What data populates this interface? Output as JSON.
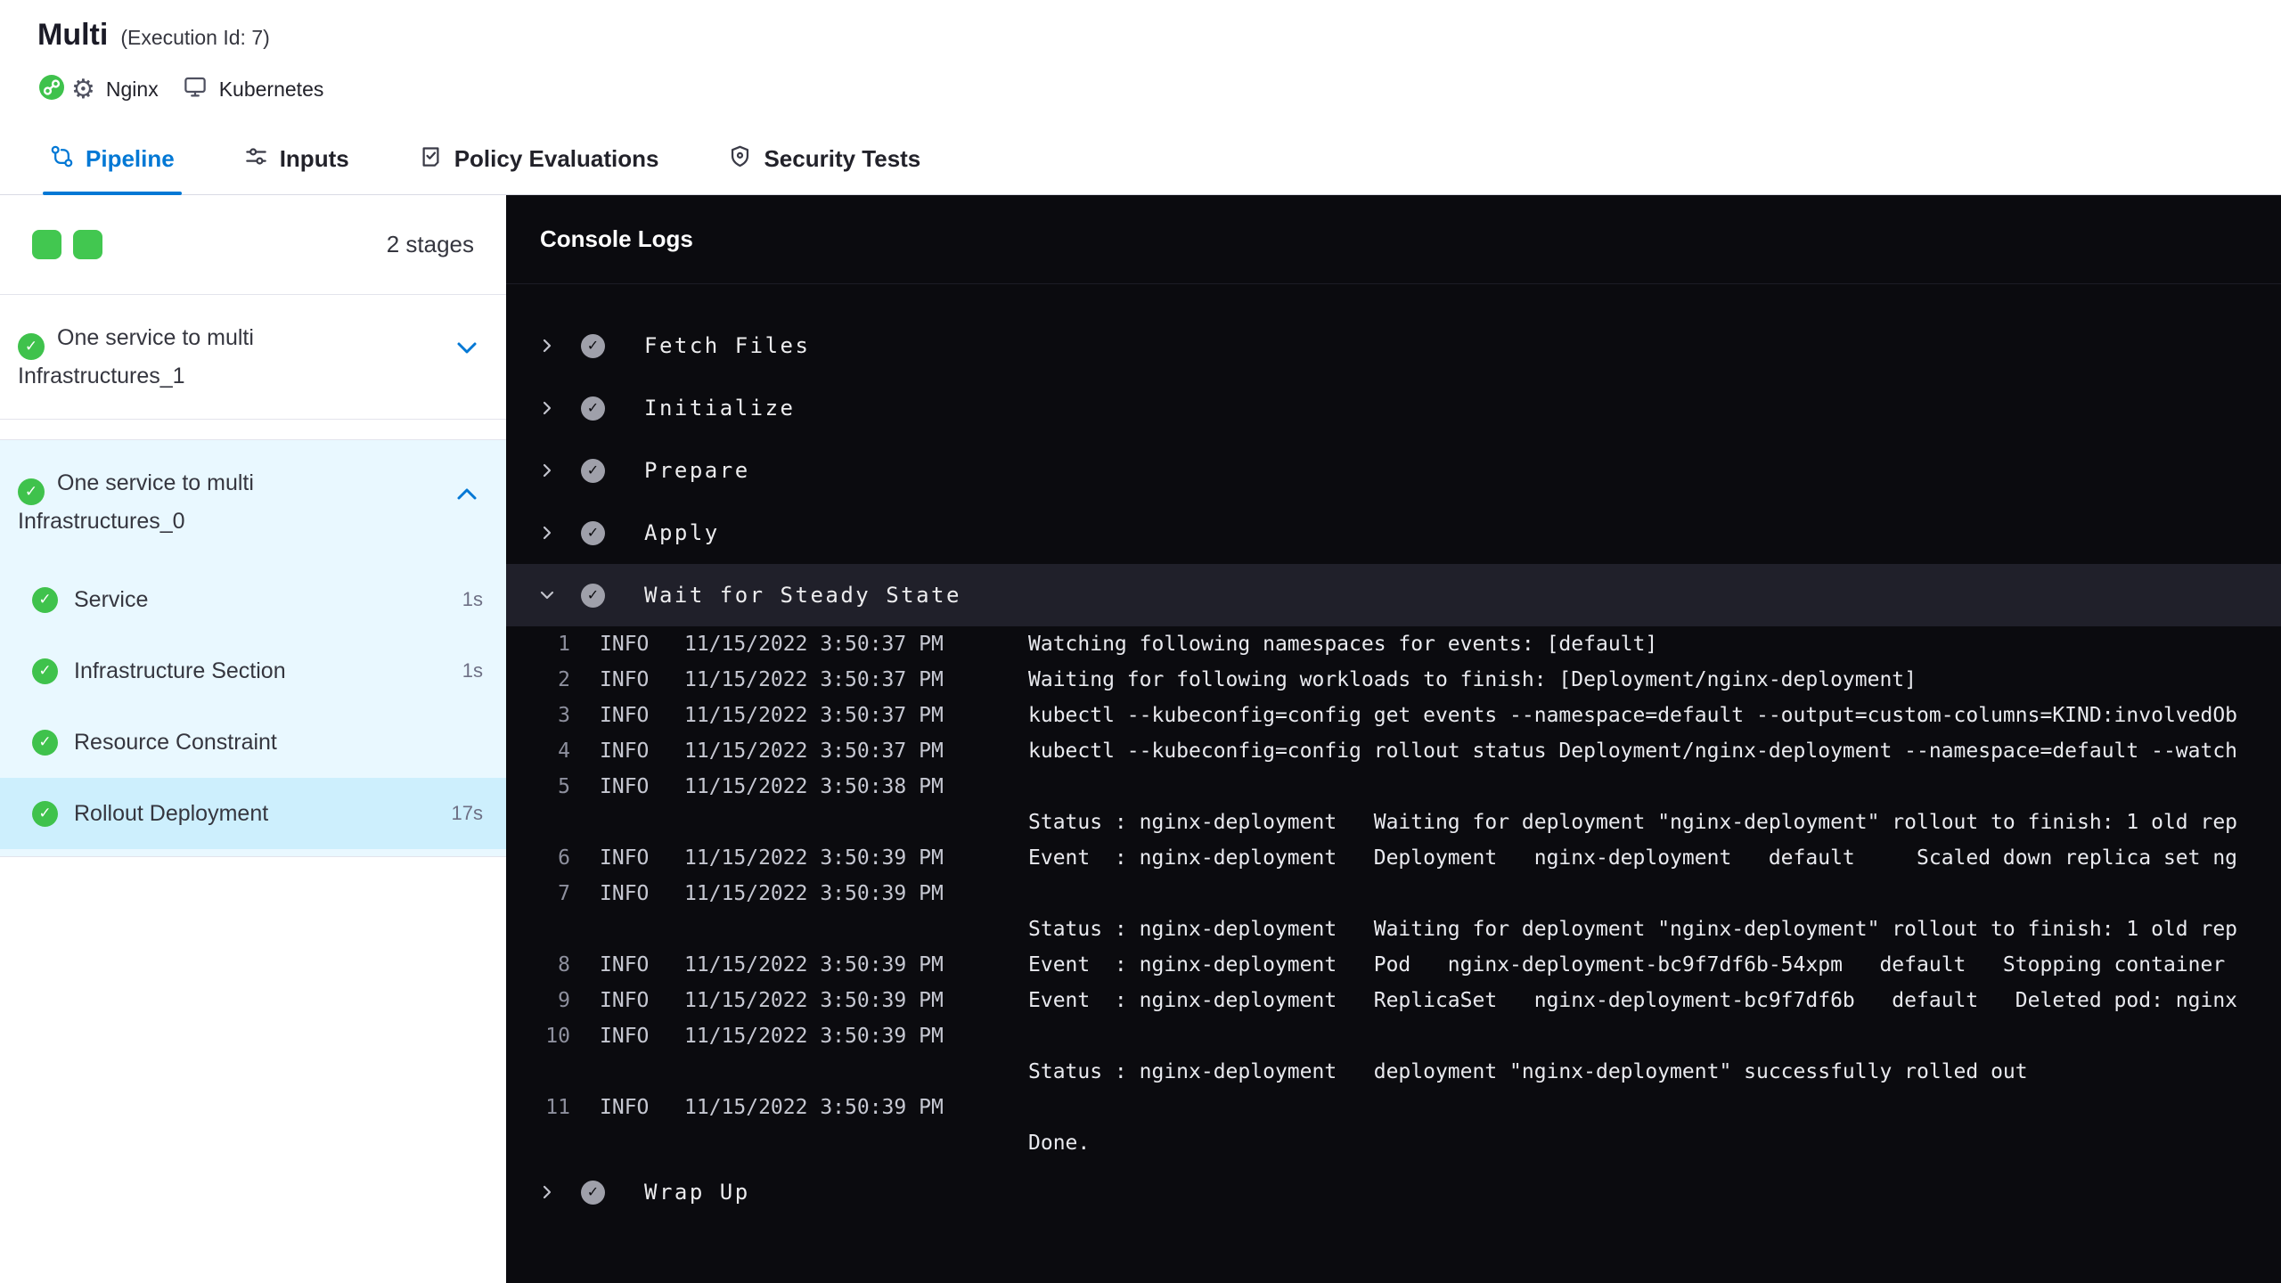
{
  "header": {
    "title": "Multi",
    "execution_id": "(Execution Id: 7)",
    "service_label": "Nginx",
    "environment_label": "Kubernetes"
  },
  "tabs": [
    {
      "label": "Pipeline",
      "active": true
    },
    {
      "label": "Inputs",
      "active": false
    },
    {
      "label": "Policy Evaluations",
      "active": false
    },
    {
      "label": "Security Tests",
      "active": false
    }
  ],
  "sidebar": {
    "stages_count": "2 stages",
    "stages": [
      {
        "name": "One service to multi Infrastructures_1",
        "expanded": false,
        "steps": []
      },
      {
        "name": "One service to multi Infrastructures_0",
        "expanded": true,
        "steps": [
          {
            "name": "Service",
            "duration": "1s",
            "selected": false
          },
          {
            "name": "Infrastructure Section",
            "duration": "1s",
            "selected": false
          },
          {
            "name": "Resource Constraint",
            "duration": "",
            "selected": false
          },
          {
            "name": "Rollout Deployment",
            "duration": "17s",
            "selected": true
          }
        ]
      }
    ]
  },
  "console": {
    "title": "Console Logs",
    "steps_before": [
      "Fetch Files",
      "Initialize",
      "Prepare",
      "Apply"
    ],
    "expanded_step": "Wait for Steady State",
    "steps_after": [
      "Wrap Up"
    ],
    "logs": [
      {
        "num": "1",
        "level": "INFO",
        "time": "11/15/2022 3:50:37 PM",
        "msg": "Watching following namespaces for events: [default]"
      },
      {
        "num": "2",
        "level": "INFO",
        "time": "11/15/2022 3:50:37 PM",
        "msg": "Waiting for following workloads to finish: [Deployment/nginx-deployment]"
      },
      {
        "num": "3",
        "level": "INFO",
        "time": "11/15/2022 3:50:37 PM",
        "msg": "kubectl --kubeconfig=config get events --namespace=default --output=custom-columns=KIND:involvedOb"
      },
      {
        "num": "4",
        "level": "INFO",
        "time": "11/15/2022 3:50:37 PM",
        "msg": "kubectl --kubeconfig=config rollout status Deployment/nginx-deployment --namespace=default --watch"
      },
      {
        "num": "5",
        "level": "INFO",
        "time": "11/15/2022 3:50:38 PM",
        "msg": ""
      },
      {
        "num": "",
        "level": "",
        "time": "",
        "msg": "Status : nginx-deployment   Waiting for deployment \"nginx-deployment\" rollout to finish: 1 old rep"
      },
      {
        "num": "6",
        "level": "INFO",
        "time": "11/15/2022 3:50:39 PM",
        "msg": "Event  : nginx-deployment   Deployment   nginx-deployment   default     Scaled down replica set ng"
      },
      {
        "num": "7",
        "level": "INFO",
        "time": "11/15/2022 3:50:39 PM",
        "msg": ""
      },
      {
        "num": "",
        "level": "",
        "time": "",
        "msg": "Status : nginx-deployment   Waiting for deployment \"nginx-deployment\" rollout to finish: 1 old rep"
      },
      {
        "num": "8",
        "level": "INFO",
        "time": "11/15/2022 3:50:39 PM",
        "msg": "Event  : nginx-deployment   Pod   nginx-deployment-bc9f7df6b-54xpm   default   Stopping container"
      },
      {
        "num": "9",
        "level": "INFO",
        "time": "11/15/2022 3:50:39 PM",
        "msg": "Event  : nginx-deployment   ReplicaSet   nginx-deployment-bc9f7df6b   default   Deleted pod: nginx"
      },
      {
        "num": "10",
        "level": "INFO",
        "time": "11/15/2022 3:50:39 PM",
        "msg": ""
      },
      {
        "num": "",
        "level": "",
        "time": "",
        "msg": "Status : nginx-deployment   deployment \"nginx-deployment\" successfully rolled out"
      },
      {
        "num": "11",
        "level": "INFO",
        "time": "11/15/2022 3:50:39 PM",
        "msg": ""
      },
      {
        "num": "",
        "level": "",
        "time": "",
        "msg": "Done."
      }
    ]
  },
  "icons": {
    "check": "✓",
    "gear": "⚙"
  },
  "colors": {
    "accent": "#0278d5",
    "success_green": "#3fc24c",
    "console_bg": "#0b0b0f",
    "expanded_row_bg": "#20202a",
    "stage_section_bg": "#e9f8ff",
    "selected_step_bg": "#cdeffd"
  }
}
